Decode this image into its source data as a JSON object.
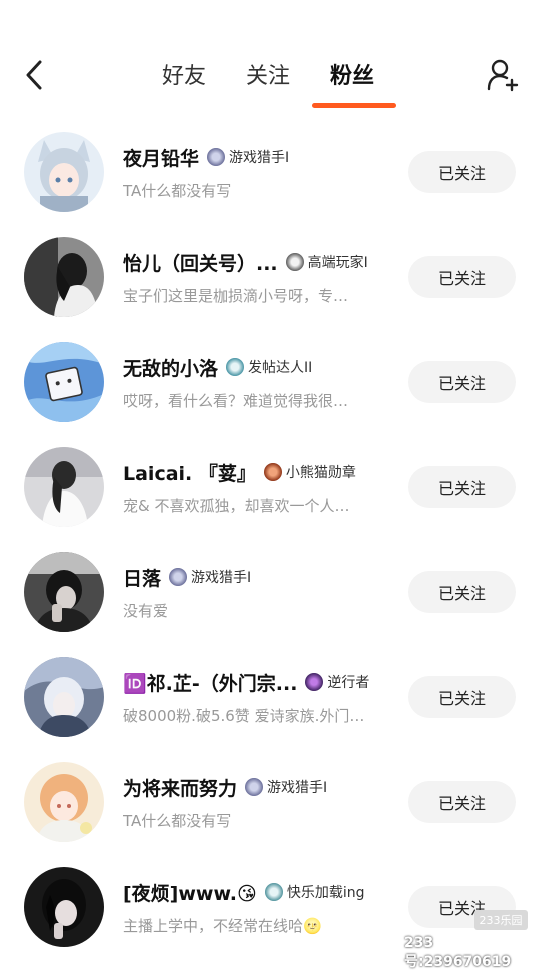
{
  "header": {
    "tabs": [
      {
        "label": "好友",
        "active": false
      },
      {
        "label": "关注",
        "active": false
      },
      {
        "label": "粉丝",
        "active": true
      }
    ],
    "accent_color": "#ff5a1f",
    "icons": {
      "back": "back-arrow-icon",
      "add": "add-user-icon"
    }
  },
  "fans": [
    {
      "name": "夜月铅华",
      "badge": "游戏猎手I",
      "bio": "TA什么都没有写",
      "button": "已关注"
    },
    {
      "name": "怡儿（回关号）...",
      "badge": "高端玩家I",
      "bio": "宝子们这里是枷损滴小号呀，专…",
      "button": "已关注"
    },
    {
      "name": "无敌的小洛",
      "badge": "发帖达人II",
      "bio": "哎呀，看什么看？难道觉得我很…",
      "button": "已关注"
    },
    {
      "name": "Laicai⁠. 『荽』",
      "badge": "小熊猫勋章",
      "bio": "宠& 不喜欢孤独，却喜欢一个人…",
      "button": "已关注"
    },
    {
      "name": "日落",
      "badge": "游戏猎手I",
      "bio": "没有爱",
      "button": "已关注"
    },
    {
      "name": "🆔祁.芷-⁠（外门宗...",
      "badge": "逆行者",
      "bio": "破8000粉.破5.6赞 爱诗家族.外门…",
      "button": "已关注"
    },
    {
      "name": "为将来而努力",
      "badge": "游戏猎手I",
      "bio": "TA什么都没有写",
      "button": "已关注"
    },
    {
      "name": "[夜烦]www.😘",
      "badge": "快乐加载ing",
      "bio": "主播上学中，不经常在线哈🌝",
      "button": "已关注"
    }
  ],
  "watermark": {
    "logo": "233乐园",
    "id": "233号:239670619"
  }
}
